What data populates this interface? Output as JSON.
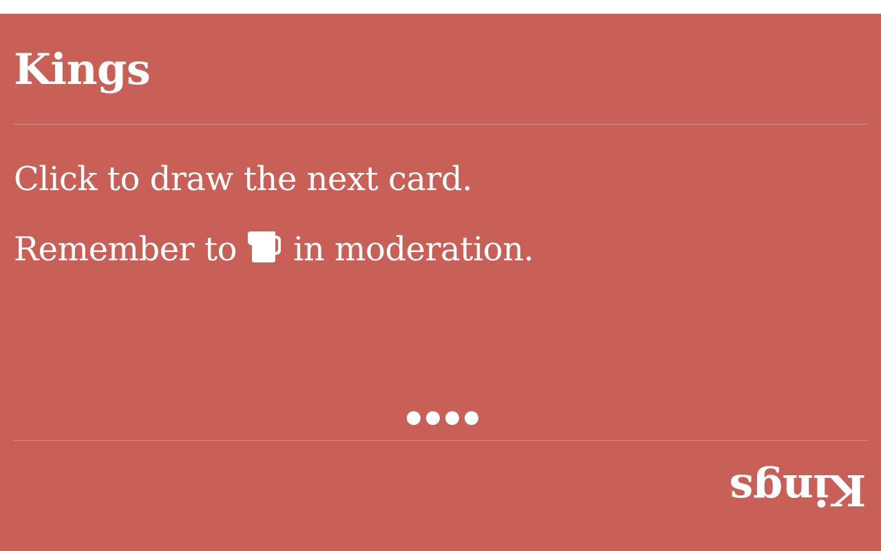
{
  "card": {
    "title": "Kings",
    "instruction": "Click to draw the next card.",
    "reminder_before": "Remember to",
    "reminder_icon": "beer-mug-icon",
    "reminder_after": "in moderation.",
    "footer_title": "Kings",
    "loading_dots": 4
  },
  "colors": {
    "card_background": "#c96058",
    "text": "#ffffff",
    "page_background": "#ffffff"
  }
}
